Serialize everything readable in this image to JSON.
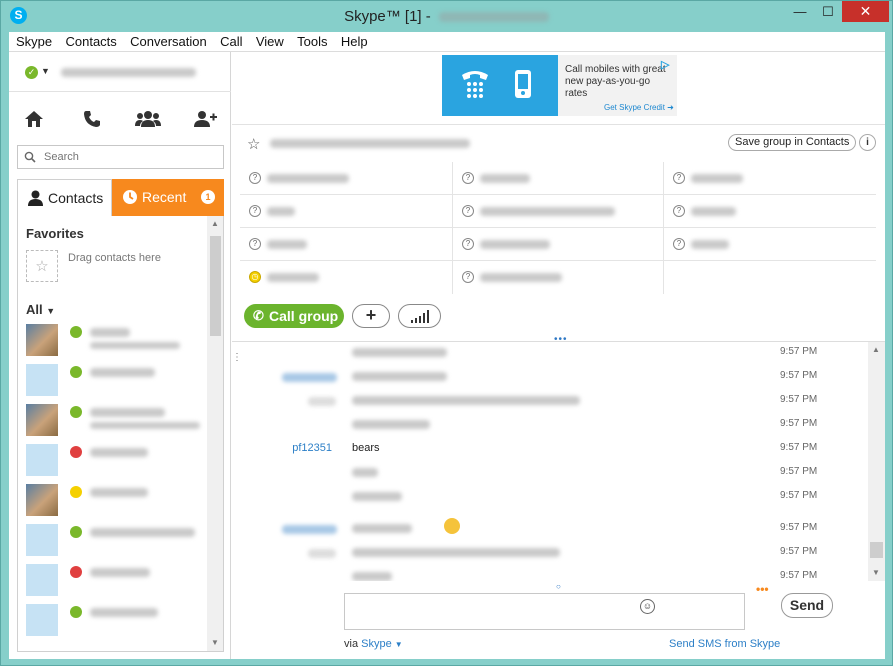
{
  "window": {
    "title_prefix": "Skype™ [1] - ",
    "app_icon": "S",
    "minimize": "—",
    "maximize": "☐",
    "close": "✕"
  },
  "menu": [
    "Skype",
    "Contacts",
    "Conversation",
    "Call",
    "View",
    "Tools",
    "Help"
  ],
  "sidebar": {
    "search_placeholder": "Search",
    "tab_contacts": "Contacts",
    "tab_recent": "Recent",
    "recent_badge": "1",
    "favorites_title": "Favorites",
    "favorites_hint": "Drag contacts here",
    "all_title": "All"
  },
  "ad": {
    "text": "Call mobiles with great new pay-as-you-go rates",
    "link": "Get Skype Credit ➜"
  },
  "group": {
    "save_button": "Save group in Contacts",
    "info": "i"
  },
  "actions": {
    "call_group": "Call group",
    "add": "+"
  },
  "chat": {
    "visible_sender": "pf12351",
    "visible_message": "bears",
    "times": [
      "9:57 PM",
      "9:57 PM",
      "9:57 PM",
      "9:57 PM",
      "9:57 PM",
      "9:57 PM",
      "9:57 PM",
      "9:57 PM",
      "9:57 PM",
      "9:57 PM"
    ]
  },
  "compose": {
    "send": "Send",
    "via_label": "via",
    "via_link": "Skype",
    "sms_link": "Send SMS from Skype",
    "typing_indicator": "•••"
  },
  "colors": {
    "accent_orange": "#f7891e",
    "online_green": "#7ab82b",
    "skype_blue": "#00aff0",
    "close_red": "#c7302a"
  }
}
